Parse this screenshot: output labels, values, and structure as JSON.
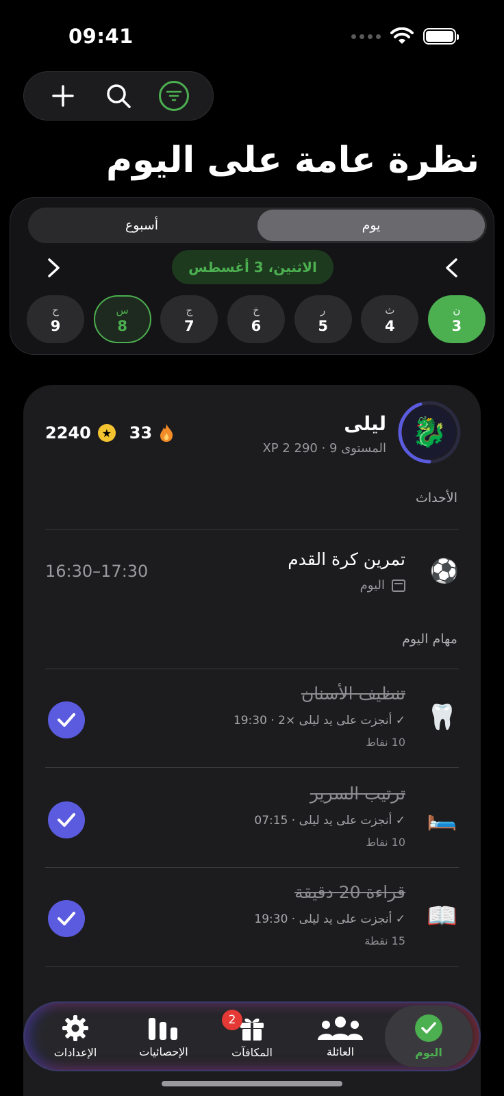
{
  "status_bar": {
    "time": "09:41"
  },
  "header": {
    "title": "نظرة عامة على اليوم"
  },
  "segmented": {
    "week_label": "أسبوع",
    "day_label": "يوم"
  },
  "date_nav": {
    "current_date": "الاثنين، 3 أغسطس",
    "days": [
      {
        "letter": "ح",
        "number": "9",
        "state": "normal"
      },
      {
        "letter": "س",
        "number": "8",
        "state": "selected"
      },
      {
        "letter": "ج",
        "number": "7",
        "state": "normal"
      },
      {
        "letter": "خ",
        "number": "6",
        "state": "normal"
      },
      {
        "letter": "ر",
        "number": "5",
        "state": "normal"
      },
      {
        "letter": "ث",
        "number": "4",
        "state": "normal"
      },
      {
        "letter": "ن",
        "number": "3",
        "state": "today"
      }
    ]
  },
  "profile": {
    "name": "ليلى",
    "level_xp": "المستوى 9 · XP 2 290",
    "xp_progress": 0.45,
    "streak": "33",
    "coins": "2240",
    "avatar_icon": "dragon-icon"
  },
  "events_section": {
    "label": "الأحداث",
    "events": [
      {
        "emoji": "⚽",
        "title": "تمرين كرة القدم",
        "day": "اليوم",
        "time": "16:30–17:30"
      }
    ]
  },
  "tasks_section": {
    "label": "مهام اليوم",
    "tasks": [
      {
        "emoji": "🦷",
        "title": "تنظيف الأسنان",
        "done_text": "✓ أنجزت على يد ليلى ×2 · 19:30",
        "points": "10 نقاط",
        "done": true
      },
      {
        "emoji": "🛏️",
        "title": "ترتيب السرير",
        "done_text": "✓ أنجزت على يد ليلى · 07:15",
        "points": "10 نقاط",
        "done": true
      },
      {
        "emoji": "📖",
        "title": "قراءة 20 دقيقة",
        "done_text": "✓ أنجزت على يد ليلى · 19:30",
        "points": "15 نقطة",
        "done": true
      }
    ]
  },
  "tab_bar": {
    "settings": "الإعدادات",
    "stats": "الإحصائيات",
    "rewards": "المكافآت",
    "rewards_badge": "2",
    "family": "العائلة",
    "today": "اليوم"
  },
  "colors": {
    "accent_green": "#4caf50",
    "check_purple": "#5b5be0",
    "badge_red": "#e53935"
  }
}
